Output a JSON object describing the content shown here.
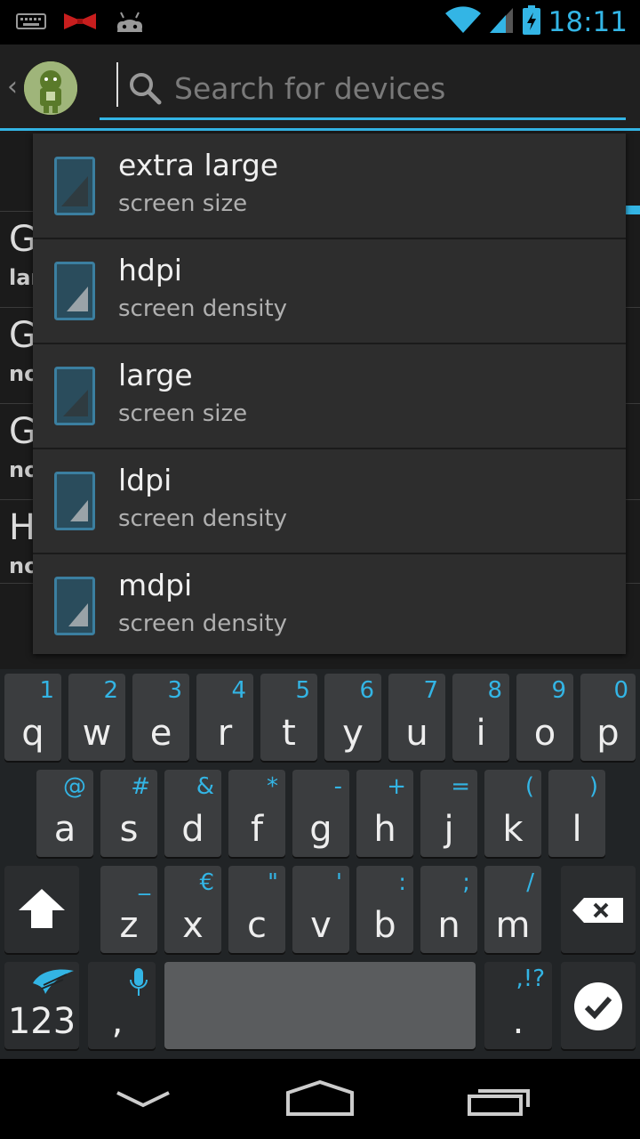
{
  "status_bar": {
    "time": "18:11",
    "icons": [
      "keyboard-icon",
      "bowtie-icon",
      "android-icon",
      "wifi-icon",
      "signal-icon",
      "battery-charging-icon"
    ]
  },
  "action_bar": {
    "app_icon": "android-avatar-icon",
    "search_placeholder": "Search for devices"
  },
  "background_list": {
    "rows": [
      {
        "letter": "G",
        "sub": "lar"
      },
      {
        "letter": "G",
        "sub": "no"
      },
      {
        "letter": "G",
        "sub": "no"
      },
      {
        "letter": "H",
        "sub": "no"
      }
    ]
  },
  "suggestions": [
    {
      "title": "extra large",
      "subtitle": "screen size",
      "icon": "device-screen-icon"
    },
    {
      "title": "hdpi",
      "subtitle": "screen density",
      "icon": "device-screen-icon"
    },
    {
      "title": "large",
      "subtitle": "screen size",
      "icon": "device-screen-icon"
    },
    {
      "title": "ldpi",
      "subtitle": "screen density",
      "icon": "device-screen-icon"
    },
    {
      "title": "mdpi",
      "subtitle": "screen density",
      "icon": "device-screen-icon"
    }
  ],
  "keyboard": {
    "row1": [
      {
        "main": "q",
        "alt": "1"
      },
      {
        "main": "w",
        "alt": "2"
      },
      {
        "main": "e",
        "alt": "3"
      },
      {
        "main": "r",
        "alt": "4"
      },
      {
        "main": "t",
        "alt": "5"
      },
      {
        "main": "y",
        "alt": "6"
      },
      {
        "main": "u",
        "alt": "7"
      },
      {
        "main": "i",
        "alt": "8"
      },
      {
        "main": "o",
        "alt": "9"
      },
      {
        "main": "p",
        "alt": "0"
      }
    ],
    "row2": [
      {
        "main": "a",
        "alt": "@"
      },
      {
        "main": "s",
        "alt": "#"
      },
      {
        "main": "d",
        "alt": "&"
      },
      {
        "main": "f",
        "alt": "*"
      },
      {
        "main": "g",
        "alt": "-"
      },
      {
        "main": "h",
        "alt": "+"
      },
      {
        "main": "j",
        "alt": "="
      },
      {
        "main": "k",
        "alt": "("
      },
      {
        "main": "l",
        "alt": ")"
      }
    ],
    "row3": [
      {
        "main": "z",
        "alt": "_"
      },
      {
        "main": "x",
        "alt": "€"
      },
      {
        "main": "c",
        "alt": "\""
      },
      {
        "main": "v",
        "alt": "'"
      },
      {
        "main": "b",
        "alt": ":"
      },
      {
        "main": "n",
        "alt": ";"
      },
      {
        "main": "m",
        "alt": "/"
      }
    ],
    "num_key": "123",
    "comma_key": ",",
    "period_key": ".",
    "period_alt": ",!?",
    "accent": "#33b5e5"
  },
  "nav_bar": {
    "icons": [
      "back-icon",
      "home-icon",
      "recent-apps-icon"
    ]
  }
}
